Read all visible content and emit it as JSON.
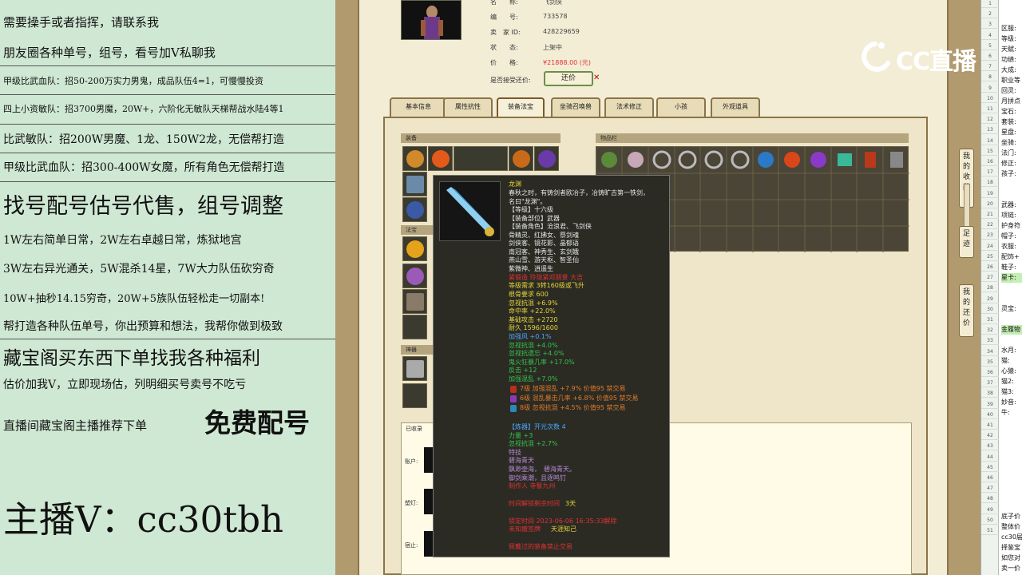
{
  "promo": {
    "lines": [
      "需要操手或者指挥，请联系我",
      "朋友圈各种单号，组号，看号加Ⅴ私聊我",
      "甲级比武血队：招50-200万实力男鬼，成品队伍4=1，可慢慢投资",
      "四上小资敏队：招3700男魔，20W+，六阶化无敏队天梯帮战水陆4等1",
      "比武敏队：招200W男魔、1龙、150W2龙，无偿帮打造",
      "甲级比武血队：招300-400W女魔，所有角色无偿帮打造",
      "找号配号估号代售，组号调整",
      "1W左右简单日常，2W左右卓越日常，炼狱地宫",
      "3W左右异光通关，5W混杀14星，7W大力队伍砍穷奇",
      "10W+抽秒14.15穷奇，20W+5族队伍轻松走一切副本!",
      "帮打造各种队伍单号，你出预算和想法，我帮你做到极致",
      "藏宝阁买东西下单找我各种福利",
      "估价加我V，立即现场估，列明细买号卖号不吃亏",
      "直播间藏宝阁主播推荐下单",
      "免费配号",
      "主播V：cc30tbh"
    ]
  },
  "item_info": {
    "rows": [
      {
        "label": "名　　称:",
        "value": "飞剑侠"
      },
      {
        "label": "编　　号:",
        "value": "733578"
      },
      {
        "label": "卖　家 ID:",
        "value": "428229659"
      },
      {
        "label": "状　　态:",
        "value": "上架中"
      },
      {
        "label": "价　　格:",
        "value": "¥21888.00 (元)"
      },
      {
        "label": "是否接受还价:",
        "value": ""
      }
    ],
    "bargain_button": "还价",
    "bargain_close": "✕"
  },
  "tabs": [
    "基本信息",
    "属性抗性",
    "装备法宝",
    "坐骑召唤兽",
    "法术修正",
    "小孩",
    "外观道具"
  ],
  "panels": {
    "equipment": "装备",
    "bag": "物品栏",
    "treasure": "法宝",
    "appearance": "神器",
    "collected": "已收录"
  },
  "collect_labels": [
    "账户:",
    "塑灯:",
    "宿止:"
  ],
  "tooltip": {
    "title": "龙渊",
    "desc": [
      "春秋之时，有铸剑者欧冶子，冶铸旷古第一铁剑，",
      "名曰\"龙渊\"。"
    ],
    "level": "【等级】十六级",
    "part": "【装备部位】武器",
    "roles_label": "【装备角色】沧浪君、飞剑侠",
    "roles": [
      "骨精灵、红拂女、祭剑魂",
      "剑侠客、镜花影、晶郁语",
      "南冠客、神秀生、玄剑娥",
      "燕山雪、游天枢、智圣仙",
      "紫微神、逍遥生"
    ],
    "forge": "紧锻造 玲珑紧邓朋景 大吉",
    "level_req": "等级需求 3转160级或飞升",
    "root_req": "根骨要求 600",
    "stats_white": [
      "忽视抗混 +6.9%",
      "命中率 +22.0%",
      "基础攻击 +2720",
      "耐久 1596/1600"
    ],
    "enhance": "加强风 +0.1%",
    "stats_green": [
      "忽视抗混 +4.0%",
      "忽视抗遗忘 +4.0%",
      "鬼火狂暴几率 +17.0%",
      "反击 +12",
      "加强混乱 +7.0%"
    ],
    "gems": [
      "7级 加强混乱 +7.9% 价值95 禁交易",
      "6级 混乱暴击几率 +6.8% 价值95 禁交易",
      "8级 忽视抗混 +4.5% 价值95 禁交易"
    ],
    "refine": "【炼器】开光次数 4",
    "refine_stats": [
      "力量 +3",
      "忽视抗混 +2.7%"
    ],
    "special": "特技",
    "poem": [
      "碧海青天",
      "飘渺壶海，　碧海青天。",
      "御剑乘潮，且逐鸣钉"
    ],
    "maker": "制作人 寺髻九州",
    "protect_label": "时间解锁剩余时间",
    "protect_days": "3天",
    "bind_time": "锁定时间 2023-06-06 16:35:33解除",
    "bind_label": "未知撤签牌",
    "bind_value": "天涯知己",
    "footer": "佩戴过的装备禁止交易"
  },
  "right_buttons": [
    "我的收藏",
    "足迹",
    "我的还价"
  ],
  "logo": {
    "text": "CC直播"
  },
  "sheet": {
    "row_numbers": [
      "1",
      "2",
      "3",
      "4",
      "5",
      "6",
      "7",
      "8",
      "9",
      "10",
      "11",
      "12",
      "13",
      "14",
      "15",
      "16",
      "17",
      "18",
      "19",
      "20",
      "21",
      "22",
      "23",
      "24",
      "25",
      "26",
      "27",
      "28",
      "29",
      "30",
      "31",
      "32",
      "33",
      "34",
      "35",
      "36",
      "37",
      "38",
      "39",
      "40",
      "41",
      "42",
      "43",
      "44",
      "45",
      "46",
      "47",
      "48",
      "49",
      "50",
      "51"
    ],
    "cells": [
      "区服:",
      "等级:",
      "天赋:",
      "功绩:",
      "大成:",
      "职业等",
      "回灵:",
      "月拼点",
      "宝石:",
      "套装:",
      "星盘:",
      "坐骑:",
      "法门:",
      "修正:",
      "孩子:",
      "",
      "",
      "武器:",
      "项链:",
      "护身符",
      "帽子:",
      "衣服:",
      "配饰+",
      "鞋子:",
      "星卡:",
      "",
      "",
      "灵宝:",
      "",
      "金履物",
      "",
      "水月:",
      "猫:",
      "心猿:",
      "猫2:",
      "猫3:",
      "妙音:",
      "牛:",
      "",
      "",
      "",
      "",
      "",
      "",
      "",
      "",
      "",
      "底子价",
      "整体价",
      "cc30届",
      "择鉴宝",
      "如您对",
      "卖一价"
    ],
    "green_rows": [
      24,
      29
    ]
  },
  "colors": {
    "promo_bg": "#cfe8d3",
    "game_paper": "#f3edd6",
    "tab_border": "#8a7448",
    "tooltip_bg": "#2b2b24",
    "price_red": "#e03232",
    "green_stat": "#34c24a",
    "blue_stat": "#4aa6ff",
    "orange_stat": "#e07a2a",
    "yellow_stat": "#e6d43a"
  }
}
